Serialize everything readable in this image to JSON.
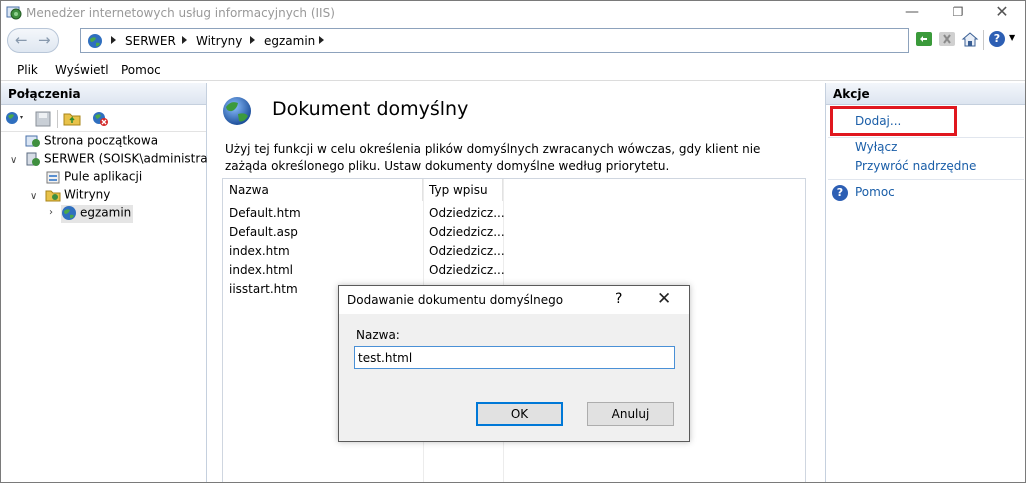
{
  "window": {
    "title": "Menedżer internetowych usług informacyjnych (IIS)"
  },
  "breadcrumb": [
    "SERWER",
    "Witryny",
    "egzamin"
  ],
  "menu": [
    "Plik",
    "Wyświetl",
    "Pomoc"
  ],
  "connections": {
    "header": "Połączenia",
    "tree": [
      {
        "label": "Strona początkowa",
        "icon": "start-page-icon"
      },
      {
        "label": "SERWER (SOISK\\administrator)",
        "icon": "server-icon"
      },
      {
        "label": "Pule aplikacji",
        "icon": "app-pools-icon"
      },
      {
        "label": "Witryny",
        "icon": "sites-folder-icon"
      },
      {
        "label": "egzamin",
        "icon": "globe-icon"
      }
    ]
  },
  "feature": {
    "title": "Dokument domyślny",
    "description": "Użyj tej funkcji w celu określenia plików domyślnych zwracanych wówczas, gdy klient nie zażąda określonego pliku. Ustaw dokumenty domyślne według priorytetu.",
    "columns": [
      "Nazwa",
      "Typ wpisu"
    ],
    "rows": [
      {
        "name": "Default.htm",
        "type": "Odziedzicz..."
      },
      {
        "name": "Default.asp",
        "type": "Odziedzicz..."
      },
      {
        "name": "index.htm",
        "type": "Odziedzicz..."
      },
      {
        "name": "index.html",
        "type": "Odziedzicz..."
      },
      {
        "name": "iisstart.htm",
        "type": ""
      }
    ]
  },
  "actions": {
    "header": "Akcje",
    "add": "Dodaj...",
    "disable": "Wyłącz",
    "revert": "Przywróć nadrzędne",
    "help": "Pomoc"
  },
  "dialog": {
    "title": "Dodawanie dokumentu domyślnego",
    "help_glyph": "?",
    "label": "Nazwa:",
    "value": "test.html",
    "ok": "OK",
    "cancel": "Anuluj"
  },
  "colors": {
    "highlight": "#e0171e",
    "link": "#1a5ea8",
    "pane_header": "#dde5f0"
  }
}
